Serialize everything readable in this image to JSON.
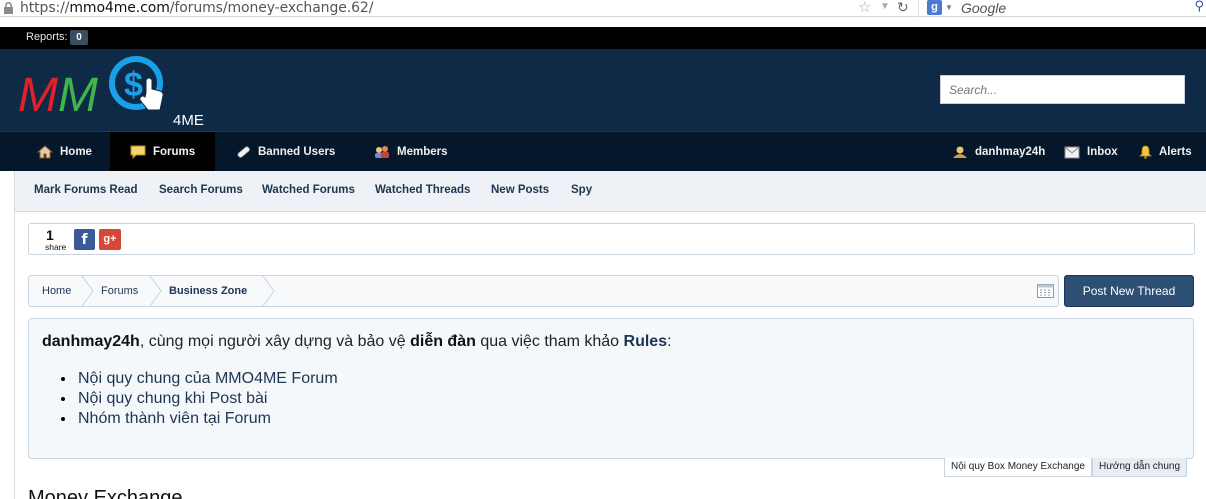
{
  "browser": {
    "url_prefix": "https://",
    "url_domain": "mmo4me.com",
    "url_path": "/forums/money-exchange.62/",
    "search_placeholder": "Google"
  },
  "staff_bar": {
    "reports_label": "Reports:",
    "reports_count": "0"
  },
  "header": {
    "logo_text": "MM",
    "logo_suffix": "4ME",
    "search_placeholder": "Search..."
  },
  "nav": {
    "tabs": [
      {
        "label": "Home",
        "icon": "house-icon"
      },
      {
        "label": "Forums",
        "icon": "speech-bubble-icon",
        "selected": true
      },
      {
        "label": "Banned Users",
        "icon": "bandage-icon"
      },
      {
        "label": "Members",
        "icon": "users-icon"
      }
    ],
    "user": {
      "username": "danhmay24h",
      "inbox_label": "Inbox",
      "alerts_label": "Alerts"
    }
  },
  "sub_nav": {
    "links": [
      "Mark Forums Read",
      "Search Forums",
      "Watched Forums",
      "Watched Threads",
      "New Posts",
      "Spy"
    ]
  },
  "share": {
    "count": "1",
    "label": "share"
  },
  "breadcrumb": {
    "items": [
      "Home",
      "Forums",
      "Business Zone"
    ]
  },
  "post_thread_label": "Post New Thread",
  "notice": {
    "username": "danhmay24h",
    "text_1": ", cùng mọi người xây dựng và bảo vệ ",
    "bold_word": "diễn đàn",
    "text_2": " qua việc tham khảo ",
    "rules_label": "Rules",
    "text_3": ":",
    "items": [
      "Nội quy chung của MMO4ME Forum",
      "Nội quy chung khi Post bài",
      "Nhóm thành viên tại Forum"
    ],
    "tabs": [
      "Nội quy Box Money Exchange",
      "Hướng dẫn chung"
    ]
  },
  "forum_title": "Money Exchange",
  "colors": {
    "header_bg": "#0e2a47",
    "nav_bg": "#05182b",
    "accent": "#2d4f73",
    "logo_ring": "#1aa0e8"
  }
}
